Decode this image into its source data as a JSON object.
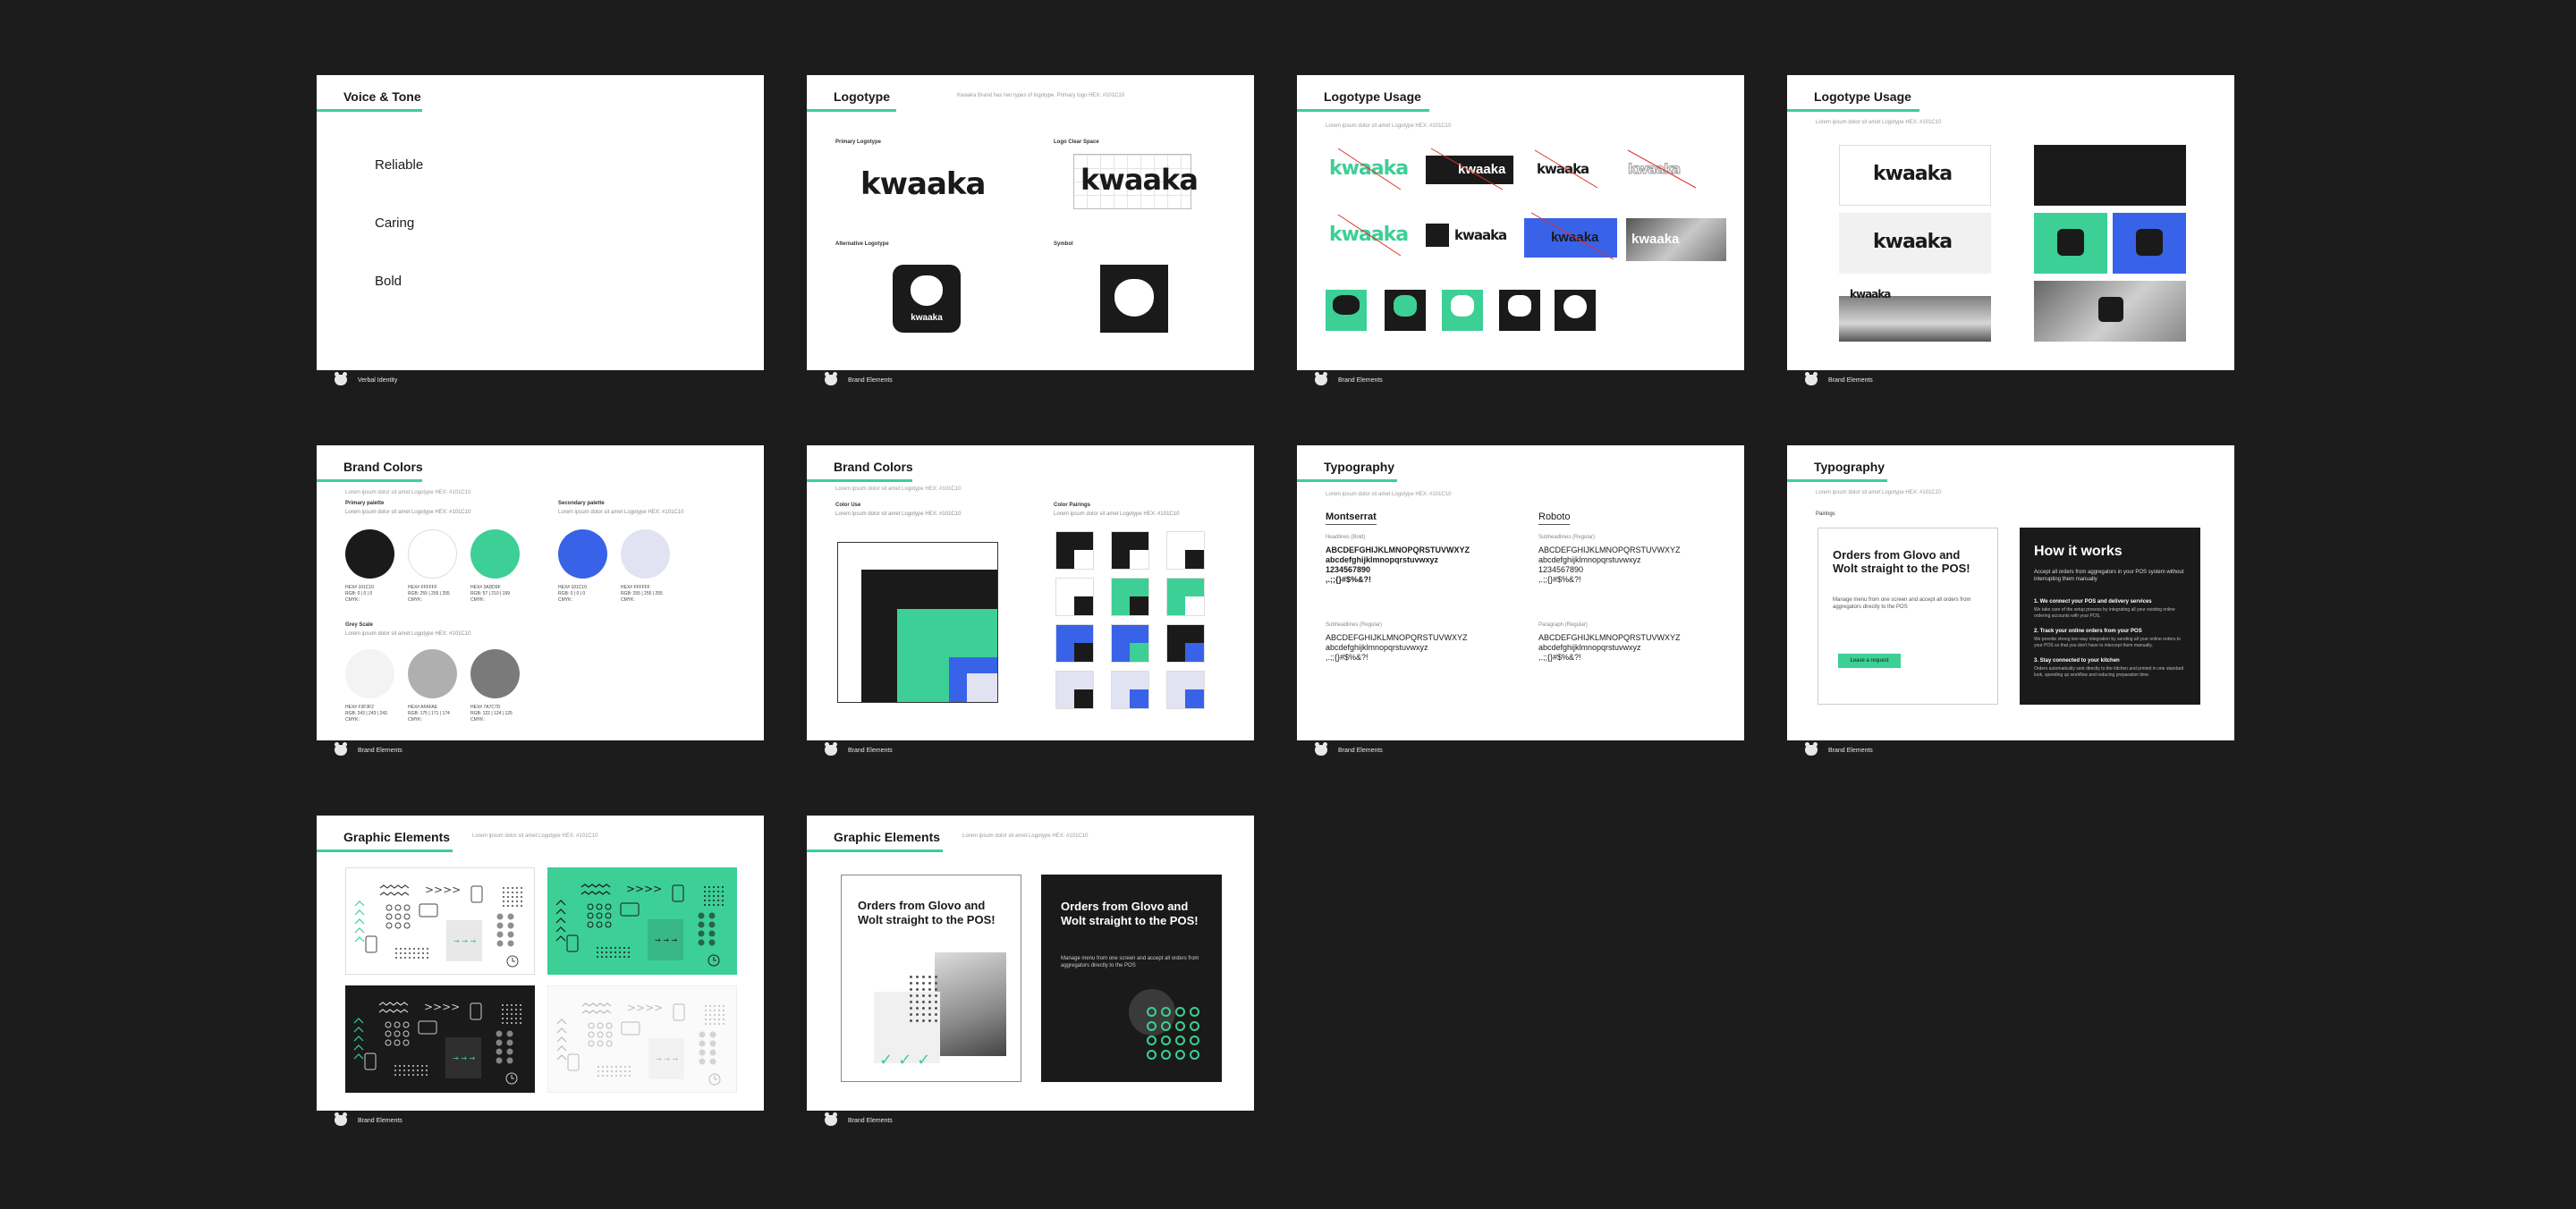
{
  "slides": {
    "voice": {
      "title": "Voice & Tone",
      "tones": [
        "Reliable",
        "Caring",
        "Bold"
      ],
      "footer": "Verbal Identity"
    },
    "logotype": {
      "title": "Logotype",
      "desc": "Kwaaka Brand has two types of logotype. Primary logo HEX: #101C10",
      "primary_label": "Primary Logotype",
      "clear_label": "Logo Clear Space",
      "alt_label": "Alternative Logotype",
      "symbol_label": "Symbol",
      "wordmark": "kwaaka",
      "footer": "Brand Elements"
    },
    "usage1": {
      "title": "Logotype Usage",
      "desc": "Lorem ipsum dolor sit amet Logotype HEX: #101C10",
      "wordmark": "kwaaka",
      "footer": "Brand Elements"
    },
    "usage2": {
      "title": "Logotype Usage",
      "desc": "Lorem ipsum dolor sit amet Logotype HEX: #101C10",
      "wordmark": "kwaaka",
      "footer": "Brand Elements"
    },
    "colors1": {
      "title": "Brand Colors",
      "desc": "Lorem ipsum dolor sit amet Logotype HEX: #101C10",
      "primary_label": "Primary palette",
      "primary_desc": "Lorem ipsum dolor sit amet Logotype HEX: #101C10",
      "secondary_label": "Secondary palette",
      "secondary_desc": "Lorem ipsum dolor sit amet Logotype HEX: #101C10",
      "grey_label": "Grey Scale",
      "grey_desc": "Lorem ipsum dolor sit amet Logotype HEX: #101C10",
      "primary": [
        {
          "color": "#1a1a1a",
          "info": "HEX# 101C10\nRGB: 0 | 0 | 0\nCMYK:"
        },
        {
          "color": "#ffffff",
          "info": "HEX# FFFFFF\nRGB: 255 | 255 | 255\nCMYK:"
        },
        {
          "color": "#3ccf96",
          "info": "HEX# 3ADD9F\nRGB: 57 | 210 | 159\nCMYK:"
        }
      ],
      "secondary": [
        {
          "color": "#3862e8",
          "info": "HEX# 101C10\nRGB: 0 | 0 | 0\nCMYK:"
        },
        {
          "color": "#e1e3f3",
          "info": "HEX# FFFFFF\nRGB: 255 | 255 | 255\nCMYK:"
        }
      ],
      "grey": [
        {
          "color": "#f3f3f3",
          "info": "HEX# F3F3F2\nRGB: 243 | 243 | 243\nCMYK:"
        },
        {
          "color": "#afafaf",
          "info": "HEX# AFAFAE\nRGB: 175 | 171 | 174\nCMYK:"
        },
        {
          "color": "#7a7a7a",
          "info": "HEX# 7A7C7D\nRGB: 122 | 124 | 125\nCMYK:"
        }
      ],
      "footer": "Brand Elements"
    },
    "colors2": {
      "title": "Brand Colors",
      "desc": "Lorem ipsum dolor sit amet Logotype HEX: #101C10",
      "use_label": "Color Use",
      "use_desc": "Lorem ipsum dolor sit amet Logotype HEX: #101C10",
      "pair_label": "Color Pairings",
      "pair_desc": "Lorem ipsum dolor sit amet Logotype HEX: #101C10",
      "footer": "Brand Elements"
    },
    "typo1": {
      "title": "Typography",
      "desc": "Lorem ipsum dolor sit amet Logotype HEX: #101C10",
      "font1": "Montserrat",
      "font1_sub1": "Headlines (Bold)",
      "font1_sub2": "Subheadlines (Regular)",
      "font2": "Roboto",
      "font2_sub1": "Subheadlines (Regular)",
      "font2_sub2": "Paragraph (Regular)",
      "upper": "ABCDEFGHIJKLMNOPQRSTUVWXYZ",
      "lower": "abcdefghijklmnopqrstuvwxyz",
      "digits": "1234567890",
      "symbols": ",.;;{}#$%&?!",
      "footer": "Brand Elements"
    },
    "typo2": {
      "title": "Typography",
      "desc": "Lorem ipsum dolor sit amet Logotype HEX: #101C10",
      "pairings": "Pairings",
      "headline": "Orders from Glovo and Wolt straight to the POS!",
      "body": "Manage menu from one screen and accept all orders from aggregators directly to the POS",
      "button": "Leave a request",
      "dark_title": "How it works",
      "dark_intro": "Accept all orders from aggregators in your POS system without interrupting them manually",
      "steps": [
        {
          "title": "1. We connect your POS and delivery services",
          "text": "We take care of the setup process by integrating all your existing online ordering accounts with your POS."
        },
        {
          "title": "2. Track your online orders from your POS",
          "text": "We provide strong two-way integration by sending all your online orders to your POS so that you don't have to intercept them manually."
        },
        {
          "title": "3. Stay connected to your kitchen",
          "text": "Orders automatically sent directly to the kitchen and printed in one standard look, speeding up workflow and reducing preparation time."
        }
      ],
      "footer": "Brand Elements"
    },
    "graphic1": {
      "title": "Graphic Elements",
      "desc": "Lorem ipsum dolor sit amet Logotype HEX: #101C10",
      "arrows": ">>>>",
      "footer": "Brand Elements"
    },
    "graphic2": {
      "title": "Graphic Elements",
      "desc": "Lorem ipsum dolor sit amet Logotype HEX: #101C10",
      "headline": "Orders from Glovo and Wolt straight to the POS!",
      "body": "Manage menu from one screen and accept all orders from aggregators directly to the POS",
      "footer": "Brand Elements"
    }
  },
  "colors": {
    "background": "#1c1c1c",
    "accent": "#3ccf96",
    "dark": "#1a1a1a",
    "blue": "#3862e8",
    "lavender": "#e1e3f3"
  }
}
